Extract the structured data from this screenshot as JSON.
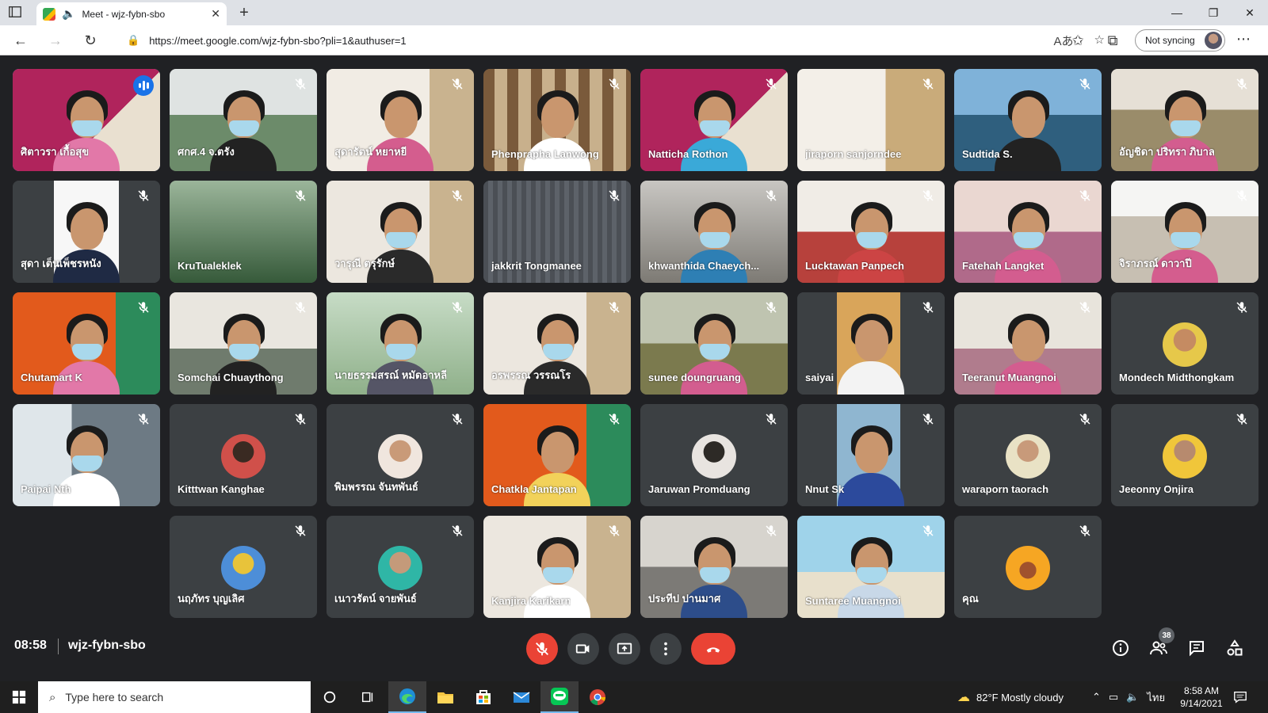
{
  "browser": {
    "tab_title": "Meet - wjz-fybn-sbo",
    "url": "https://meet.google.com/wjz-fybn-sbo?pli=1&authuser=1",
    "sync_label": "Not syncing"
  },
  "meeting": {
    "time": "08:58",
    "code": "wjz-fybn-sbo",
    "participant_count": "38"
  },
  "tiles": [
    {
      "name": "ศิตาวรา เกื้อสุข",
      "speaking": true
    },
    {
      "name": "ศกศ.4 จ.ตรัง"
    },
    {
      "name": "สุดารัตน์ หยาหยี"
    },
    {
      "name": "Phenprapha Lanwong"
    },
    {
      "name": "Natticha Rothon"
    },
    {
      "name": "jiraporn sanjorndee"
    },
    {
      "name": "Sudtida S."
    },
    {
      "name": "อัญชิดา ปริทรา ภิบาล"
    },
    {
      "name": "สุดา เต็นเพ็ชรหนัง"
    },
    {
      "name": "KruTualeklek"
    },
    {
      "name": "วารุณี ตรุรักษ์"
    },
    {
      "name": "jakkrit Tongmanee"
    },
    {
      "name": "khwanthida Chaeych..."
    },
    {
      "name": "Lucktawan Panpech"
    },
    {
      "name": "Fatehah Langket"
    },
    {
      "name": "จิราภรณ์ ดาวาปี"
    },
    {
      "name": "Chutamart K"
    },
    {
      "name": "Somchai Chuaythong"
    },
    {
      "name": "นายธรรมสรณ์ หมัดอาหลี"
    },
    {
      "name": "อรพรรณ วรรณโร"
    },
    {
      "name": "sunee doungruang"
    },
    {
      "name": "saiyai"
    },
    {
      "name": "Teeranut Muangnoi"
    },
    {
      "name": "Mondech Midthongkam"
    },
    {
      "name": "Paipai Nth"
    },
    {
      "name": "Kitttwan Kanghae"
    },
    {
      "name": "พิมพรรณ จันทพันธ์"
    },
    {
      "name": "Chatkla Jantapan"
    },
    {
      "name": "Jaruwan Promduang"
    },
    {
      "name": "Nnut Sk"
    },
    {
      "name": "waraporn taorach"
    },
    {
      "name": "Jeeonny Onjira"
    },
    {
      "name": "นฤภัทร บุญเลิศ"
    },
    {
      "name": "เนาวรัตน์ จายพันธ์"
    },
    {
      "name": "Kanjira Karikarn"
    },
    {
      "name": "ประทีป ปานมาศ"
    },
    {
      "name": "Suntaree Muangnoi"
    },
    {
      "name": "คุณ"
    }
  ],
  "taskbar": {
    "search_placeholder": "Type here to search",
    "weather": "82°F  Mostly cloudy",
    "lang": "ไทย",
    "time": "8:58 AM",
    "date": "9/14/2021"
  },
  "colors": {
    "meet_bg": "#202124",
    "tile_bg": "#3c4043",
    "end_call": "#ea4335",
    "active_border": "#8ab4f8"
  }
}
